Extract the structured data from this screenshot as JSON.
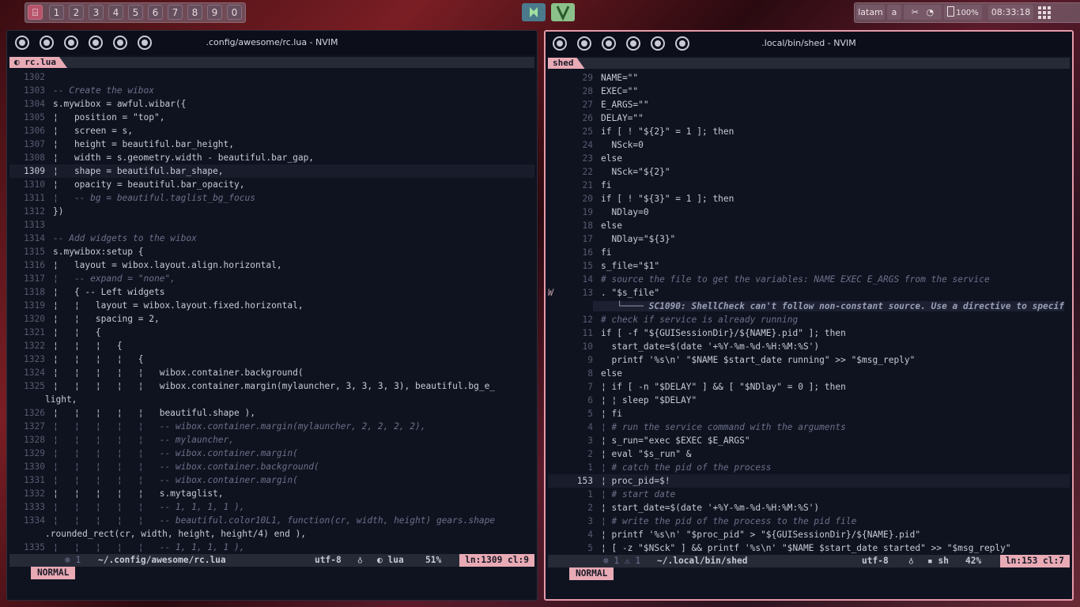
{
  "topbar": {
    "tags": [
      "1",
      "2",
      "3",
      "4",
      "5",
      "6",
      "7",
      "8",
      "9",
      "0"
    ],
    "layout_label": "latam",
    "kbd_label": "a",
    "battery": "100%",
    "clock": "08:33:18"
  },
  "left_window": {
    "title": ".config/awesome/rc.lua - NVIM",
    "tab": "rc.lua",
    "status": {
      "mode": "NORMAL",
      "diag": "⊗ 1",
      "file": "~/.config/awesome/rc.lua",
      "encoding": "utf-8",
      "filetype": "lua",
      "percent": "51%",
      "position": "ln:1309 cl:9"
    },
    "lines": [
      {
        "n": "1302",
        "t": ""
      },
      {
        "n": "1303",
        "t": "-- Create the wibox"
      },
      {
        "n": "1304",
        "t": "s.mywibox = awful.wibar({"
      },
      {
        "n": "1305",
        "t": "¦   position = \"top\","
      },
      {
        "n": "1306",
        "t": "¦   screen = s,"
      },
      {
        "n": "1307",
        "t": "¦   height = beautiful.bar_height,"
      },
      {
        "n": "1308",
        "t": "¦   width = s.geometry.width - beautiful.bar_gap,"
      },
      {
        "n": "1309",
        "t": "¦   shape = beautiful.bar_shape,"
      },
      {
        "n": "1310",
        "t": "¦   opacity = beautiful.bar_opacity,"
      },
      {
        "n": "1311",
        "t": "¦   -- bg = beautiful.taglist_bg_focus"
      },
      {
        "n": "1312",
        "t": "})"
      },
      {
        "n": "1313",
        "t": ""
      },
      {
        "n": "1314",
        "t": "-- Add widgets to the wibox"
      },
      {
        "n": "1315",
        "t": "s.mywibox:setup {"
      },
      {
        "n": "1316",
        "t": "¦   layout = wibox.layout.align.horizontal,"
      },
      {
        "n": "1317",
        "t": "¦   -- expand = \"none\","
      },
      {
        "n": "1318",
        "t": "¦   { -- Left widgets"
      },
      {
        "n": "1319",
        "t": "¦   ¦   layout = wibox.layout.fixed.horizontal,"
      },
      {
        "n": "1320",
        "t": "¦   ¦   spacing = 2,"
      },
      {
        "n": "1321",
        "t": "¦   ¦   {"
      },
      {
        "n": "1322",
        "t": "¦   ¦   ¦   {"
      },
      {
        "n": "1323",
        "t": "¦   ¦   ¦   ¦   {"
      },
      {
        "n": "1324",
        "t": "¦   ¦   ¦   ¦   ¦   wibox.container.background("
      },
      {
        "n": "1325",
        "t": "¦   ¦   ¦   ¦   ¦   wibox.container.margin(mylauncher, 3, 3, 3, 3), beautiful.bg_e_"
      },
      {
        "n": "",
        "t": "light,"
      },
      {
        "n": "1326",
        "t": "¦   ¦   ¦   ¦   ¦   beautiful.shape ),"
      },
      {
        "n": "1327",
        "t": "¦   ¦   ¦   ¦   ¦   -- wibox.container.margin(mylauncher, 2, 2, 2, 2),"
      },
      {
        "n": "1328",
        "t": "¦   ¦   ¦   ¦   ¦   -- mylauncher,"
      },
      {
        "n": "1329",
        "t": "¦   ¦   ¦   ¦   ¦   -- wibox.container.margin("
      },
      {
        "n": "1330",
        "t": "¦   ¦   ¦   ¦   ¦   -- wibox.container.background("
      },
      {
        "n": "1331",
        "t": "¦   ¦   ¦   ¦   ¦   -- wibox.container.margin("
      },
      {
        "n": "1332",
        "t": "¦   ¦   ¦   ¦   ¦   s.mytaglist,"
      },
      {
        "n": "1333",
        "t": "¦   ¦   ¦   ¦   ¦   -- 1, 1, 1, 1 ),"
      },
      {
        "n": "1334",
        "t": "¦   ¦   ¦   ¦   ¦   -- beautiful.color10L1, function(cr, width, height) gears.shape"
      },
      {
        "n": "",
        "t": ".rounded_rect(cr, width, height, height/4) end ),"
      },
      {
        "n": "1335",
        "t": "¦   ¦   ¦   ¦   ¦   -- 1, 1, 1, 1 ),"
      }
    ]
  },
  "right_window": {
    "title": ".local/bin/shed - NVIM",
    "tab": "shed",
    "status": {
      "mode": "NORMAL",
      "diag": "⊗ 1 ⚠ 1",
      "file": "~/.local/bin/shed",
      "encoding": "utf-8",
      "filetype": "sh",
      "percent": "42%",
      "position": "ln:153 cl:7"
    },
    "lines": [
      {
        "s": "",
        "n": "29",
        "t": "NAME=\"\""
      },
      {
        "s": "",
        "n": "28",
        "t": "EXEC=\"\""
      },
      {
        "s": "",
        "n": "27",
        "t": "E_ARGS=\"\""
      },
      {
        "s": "",
        "n": "26",
        "t": "DELAY=\"\""
      },
      {
        "s": "",
        "n": "25",
        "t": "if [ ! \"${2}\" = 1 ]; then"
      },
      {
        "s": "",
        "n": "24",
        "t": "  NSck=0"
      },
      {
        "s": "",
        "n": "23",
        "t": "else"
      },
      {
        "s": "",
        "n": "22",
        "t": "  NSck=\"${2}\""
      },
      {
        "s": "",
        "n": "21",
        "t": "fi"
      },
      {
        "s": "",
        "n": "20",
        "t": "if [ ! \"${3}\" = 1 ]; then"
      },
      {
        "s": "",
        "n": "19",
        "t": "  NDlay=0"
      },
      {
        "s": "",
        "n": "18",
        "t": "else"
      },
      {
        "s": "",
        "n": "17",
        "t": "  NDlay=\"${3}\""
      },
      {
        "s": "",
        "n": "16",
        "t": "fi"
      },
      {
        "s": "",
        "n": "15",
        "t": "s_file=\"$1\""
      },
      {
        "s": "",
        "n": "14",
        "t": "# source the file to get the variables: NAME EXEC E_ARGS from the service"
      },
      {
        "s": "W",
        "n": "13",
        "t": ". \"$s_file\""
      },
      {
        "s": "",
        "n": "",
        "t": "   └──── SC1090: ShellCheck can't follow non-constant source. Use a directive to specif"
      },
      {
        "s": "",
        "n": "12",
        "t": "# check if service is already running"
      },
      {
        "s": "",
        "n": "11",
        "t": "if [ -f \"${GUISessionDir}/${NAME}.pid\" ]; then"
      },
      {
        "s": "",
        "n": "10",
        "t": "  start_date=$(date '+%Y-%m-%d-%H:%M:%S')"
      },
      {
        "s": "",
        "n": "9",
        "t": "  printf '%s\\n' \"$NAME $start_date running\" >> \"$msg_reply\""
      },
      {
        "s": "",
        "n": "8",
        "t": "else"
      },
      {
        "s": "",
        "n": "7",
        "t": "¦ if [ -n \"$DELAY\" ] && [ \"$NDlay\" = 0 ]; then"
      },
      {
        "s": "",
        "n": "6",
        "t": "¦ ¦ sleep \"$DELAY\""
      },
      {
        "s": "",
        "n": "5",
        "t": "¦ fi"
      },
      {
        "s": "",
        "n": "4",
        "t": "¦ # run the service command with the arguments"
      },
      {
        "s": "",
        "n": "3",
        "t": "¦ s_run=\"exec $EXEC $E_ARGS\""
      },
      {
        "s": "",
        "n": "2",
        "t": "¦ eval \"$s_run\" &"
      },
      {
        "s": "",
        "n": "1",
        "t": "¦ # catch the pid of the process"
      },
      {
        "s": "",
        "n": "153",
        "t": "¦ proc_pid=$!"
      },
      {
        "s": "",
        "n": "1",
        "t": "¦ # start date"
      },
      {
        "s": "",
        "n": "2",
        "t": "¦ start_date=$(date '+%Y-%m-%d-%H:%M:%S')"
      },
      {
        "s": "",
        "n": "3",
        "t": "¦ # write the pid of the process to the pid file"
      },
      {
        "s": "",
        "n": "4",
        "t": "¦ printf '%s\\n' \"$proc_pid\" > \"${GUISessionDir}/${NAME}.pid\""
      },
      {
        "s": "",
        "n": "5",
        "t": "¦ [ -z \"$NSck\" ] && printf '%s\\n' \"$NAME $start_date started\" >> \"$msg_reply\""
      }
    ]
  },
  "colors": {
    "accent": "#e8aab5",
    "editor_bg": "#0f1320",
    "statusbar_bg": "#262a37"
  }
}
